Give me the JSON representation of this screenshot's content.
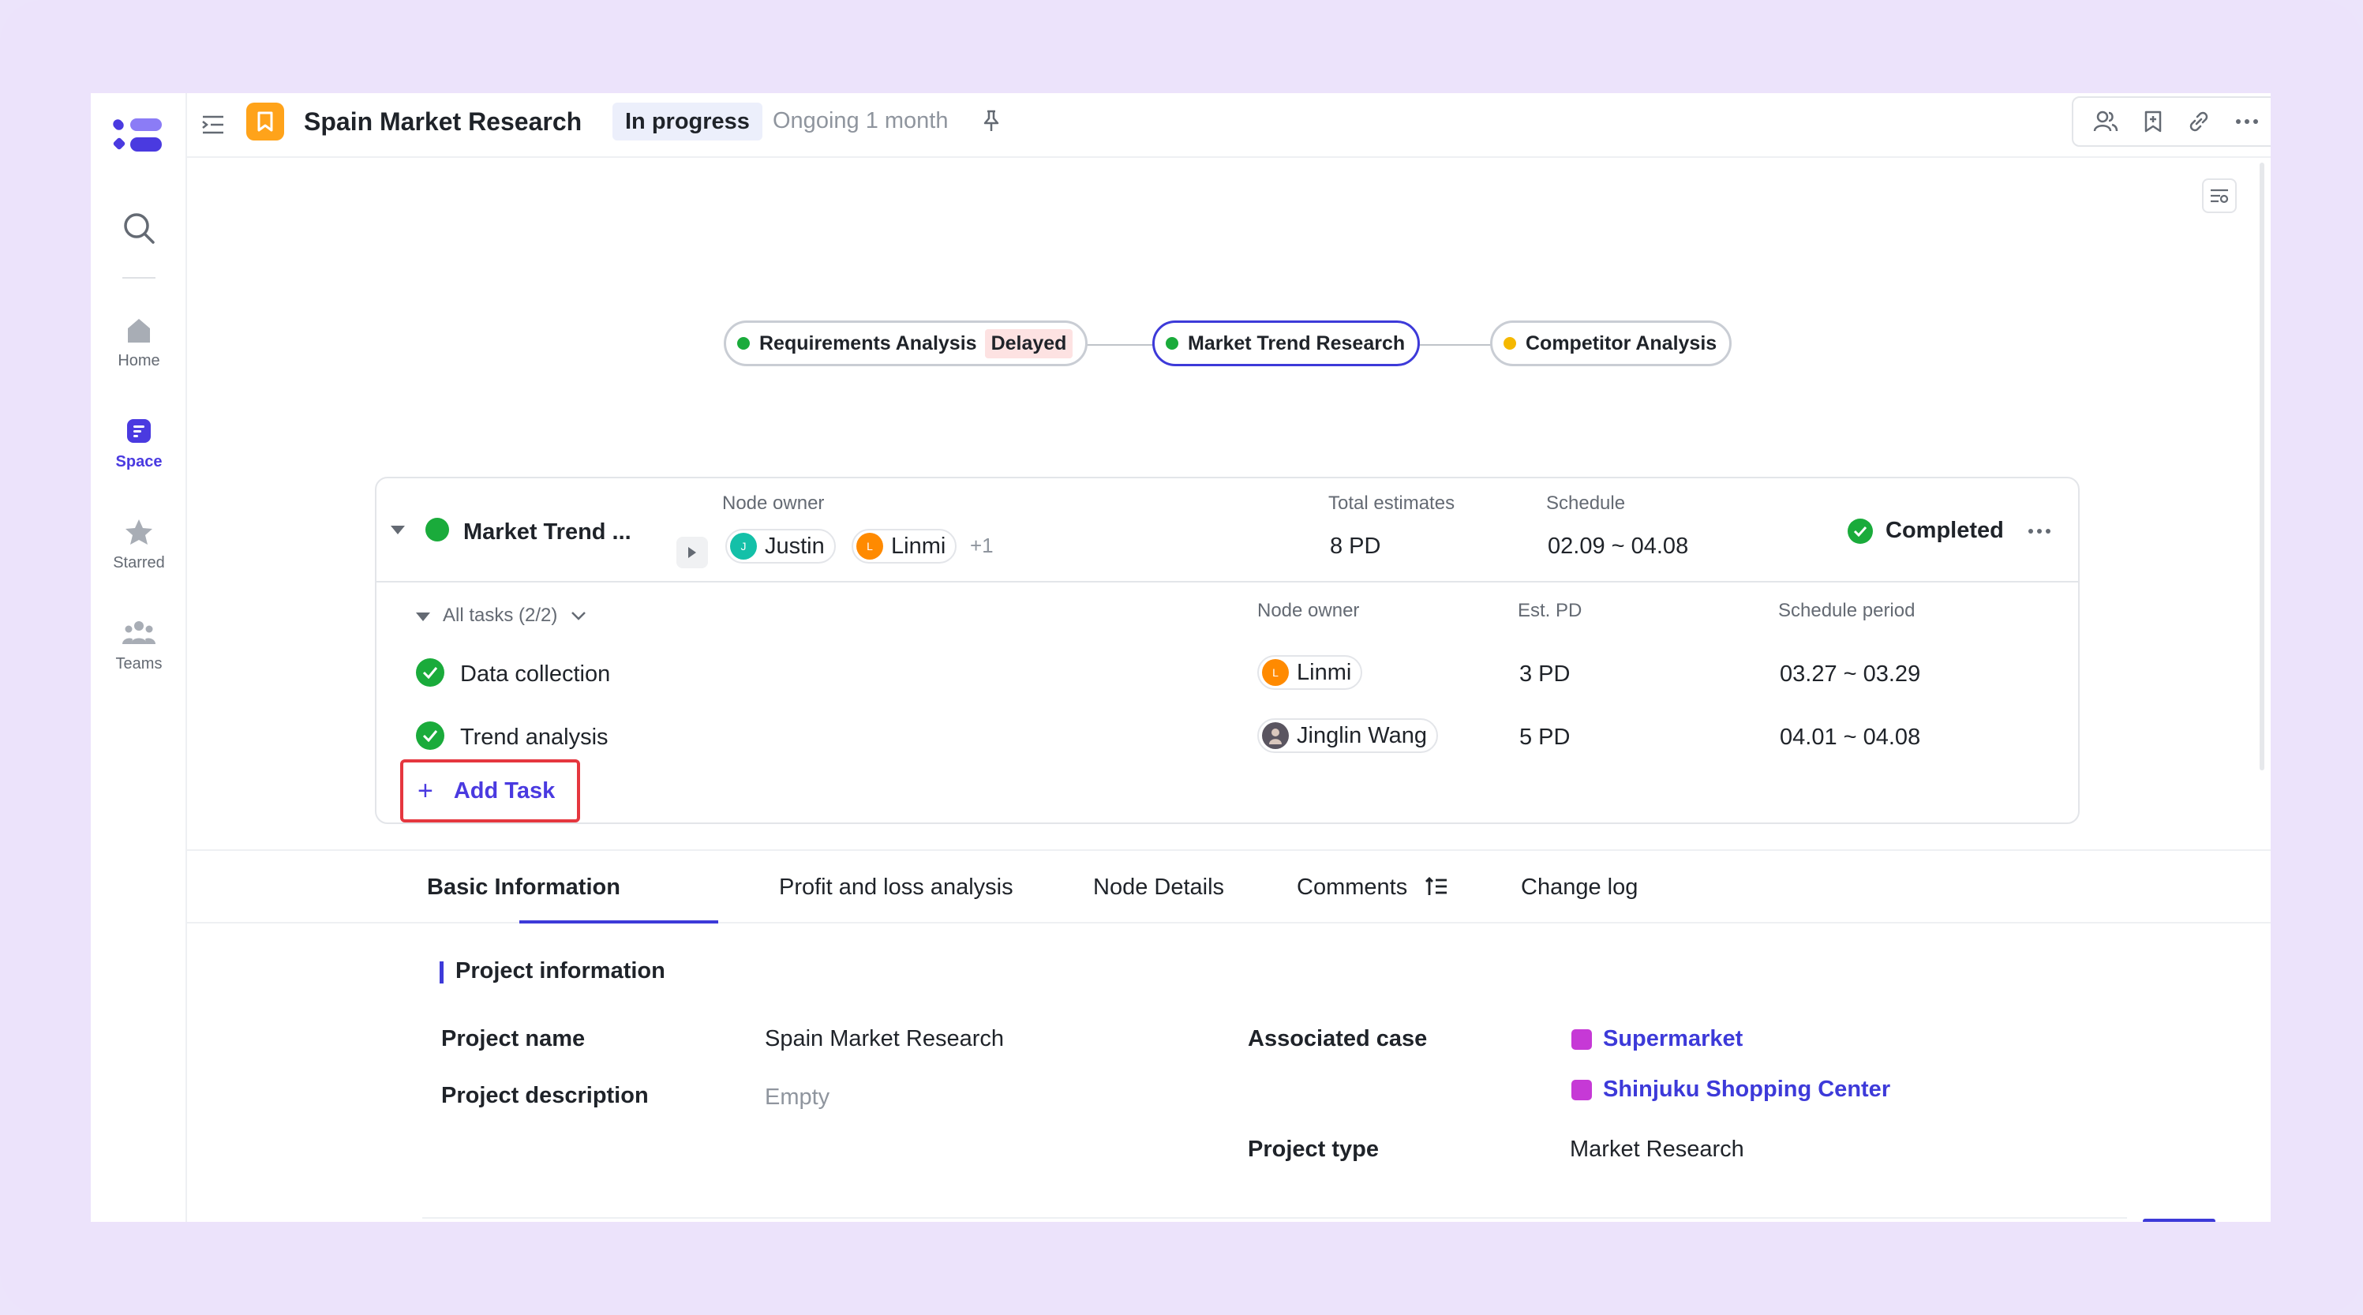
{
  "app": {
    "title": "Spain Market Research",
    "status": "In progress",
    "duration": "Ongoing 1 month"
  },
  "nav": {
    "items": [
      {
        "label": "Home",
        "icon": "home-icon"
      },
      {
        "label": "Space",
        "icon": "space-icon"
      },
      {
        "label": "Starred",
        "icon": "star-icon"
      },
      {
        "label": "Teams",
        "icon": "teams-icon"
      }
    ]
  },
  "flow": {
    "nodes": [
      {
        "label": "Requirements Analysis",
        "badge": "Delayed",
        "dot_color": "#1aab3b"
      },
      {
        "label": "Market Trend Research",
        "dot_color": "#1aab3b"
      },
      {
        "label": "Competitor Analysis",
        "dot_color": "#f5b800"
      }
    ]
  },
  "node": {
    "title": "Market Trend ...",
    "owner_label": "Node owner",
    "owners": [
      {
        "name": "Justin",
        "initial": "J",
        "color": "#14c0a8"
      },
      {
        "name": "Linmi",
        "initial": "L",
        "color": "#ff8a00"
      }
    ],
    "owners_more": "+1",
    "estimates_label": "Total estimates",
    "estimates": "8 PD",
    "schedule_label": "Schedule",
    "schedule": "02.09 ~ 04.08",
    "status": "Completed"
  },
  "tasks": {
    "header": "All tasks (2/2)",
    "col_owner": "Node owner",
    "col_est": "Est. PD",
    "col_period": "Schedule period",
    "rows": [
      {
        "name": "Data collection",
        "owner": "Linmi",
        "owner_initial": "L",
        "owner_color": "#ff8a00",
        "est": "3 PD",
        "period": "03.27 ~ 03.29"
      },
      {
        "name": "Trend analysis",
        "owner": "Jinglin Wang",
        "owner_initial": "",
        "owner_color": "#5a5560",
        "est": "5 PD",
        "period": "04.01 ~ 04.08"
      }
    ],
    "add_label": "Add Task"
  },
  "tabs": [
    "Basic Information",
    "Profit and loss analysis",
    "Node Details",
    "Comments",
    "Change log"
  ],
  "info": {
    "section_title": "Project information",
    "project_name_label": "Project name",
    "project_name": "Spain Market Research",
    "project_desc_label": "Project description",
    "project_desc": "Empty",
    "case_label": "Associated case",
    "cases": [
      "Supermarket",
      "Shinjuku Shopping Center"
    ],
    "type_label": "Project type",
    "type": "Market Research"
  }
}
